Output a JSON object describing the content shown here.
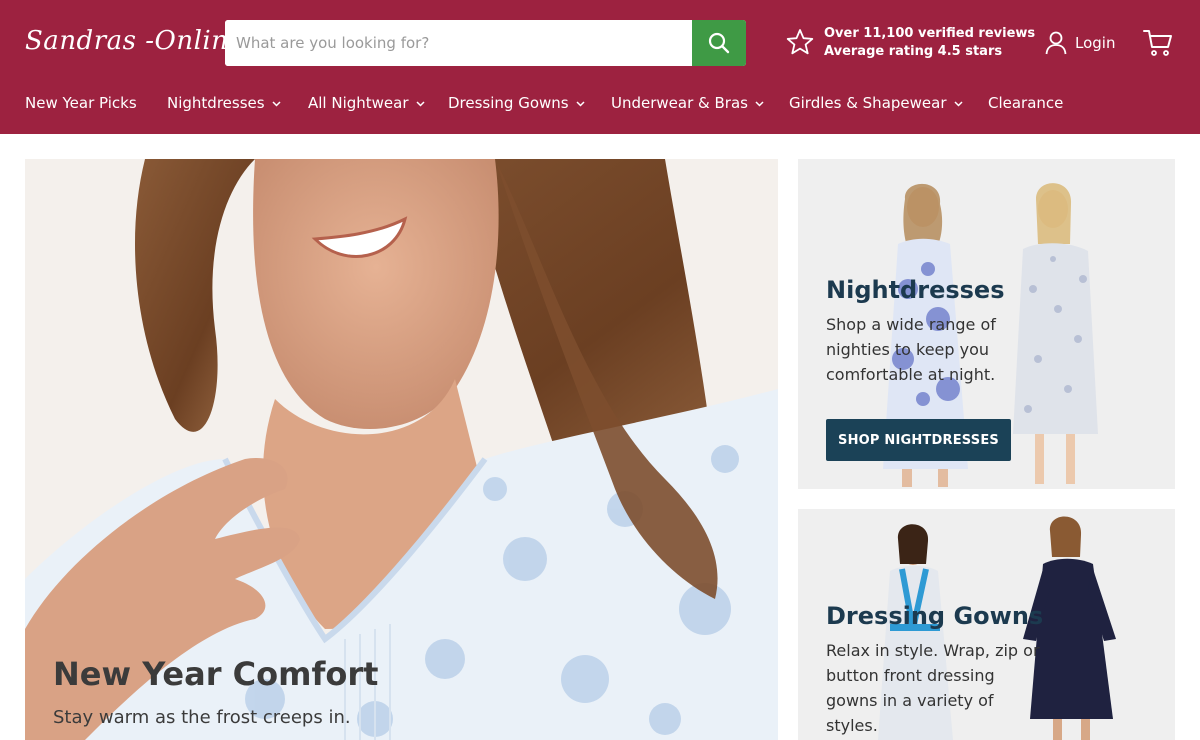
{
  "header": {
    "logo_text": "Sandras -Online",
    "search": {
      "placeholder": "What are you looking for?",
      "value": ""
    },
    "reviews": {
      "line1": "Over 11,100 verified reviews",
      "line2": "Average rating 4.5 stars"
    },
    "login_label": "Login",
    "colors": {
      "brand": "#9d2240",
      "search_button": "#3f9a45"
    }
  },
  "nav": {
    "items": [
      {
        "label": "New Year Picks",
        "has_dropdown": false
      },
      {
        "label": "Nightdresses",
        "has_dropdown": true
      },
      {
        "label": "All Nightwear",
        "has_dropdown": true
      },
      {
        "label": "Dressing Gowns",
        "has_dropdown": true
      },
      {
        "label": "Underwear & Bras",
        "has_dropdown": true
      },
      {
        "label": "Girdles & Shapewear",
        "has_dropdown": true
      },
      {
        "label": "Clearance",
        "has_dropdown": false
      }
    ]
  },
  "hero": {
    "title": "New Year Comfort",
    "subtitle": "Stay warm as the frost creeps in."
  },
  "cards": [
    {
      "title": "Nightdresses",
      "text": "Shop a wide range of nighties to keep you comfortable at night.",
      "button": "SHOP NIGHTDRESSES"
    },
    {
      "title": "Dressing Gowns",
      "text": "Relax in style. Wrap, zip or button front dressing gowns in a variety of styles."
    }
  ],
  "icons": [
    "search-icon",
    "star-icon",
    "user-icon",
    "cart-icon",
    "chevron-down-icon"
  ]
}
